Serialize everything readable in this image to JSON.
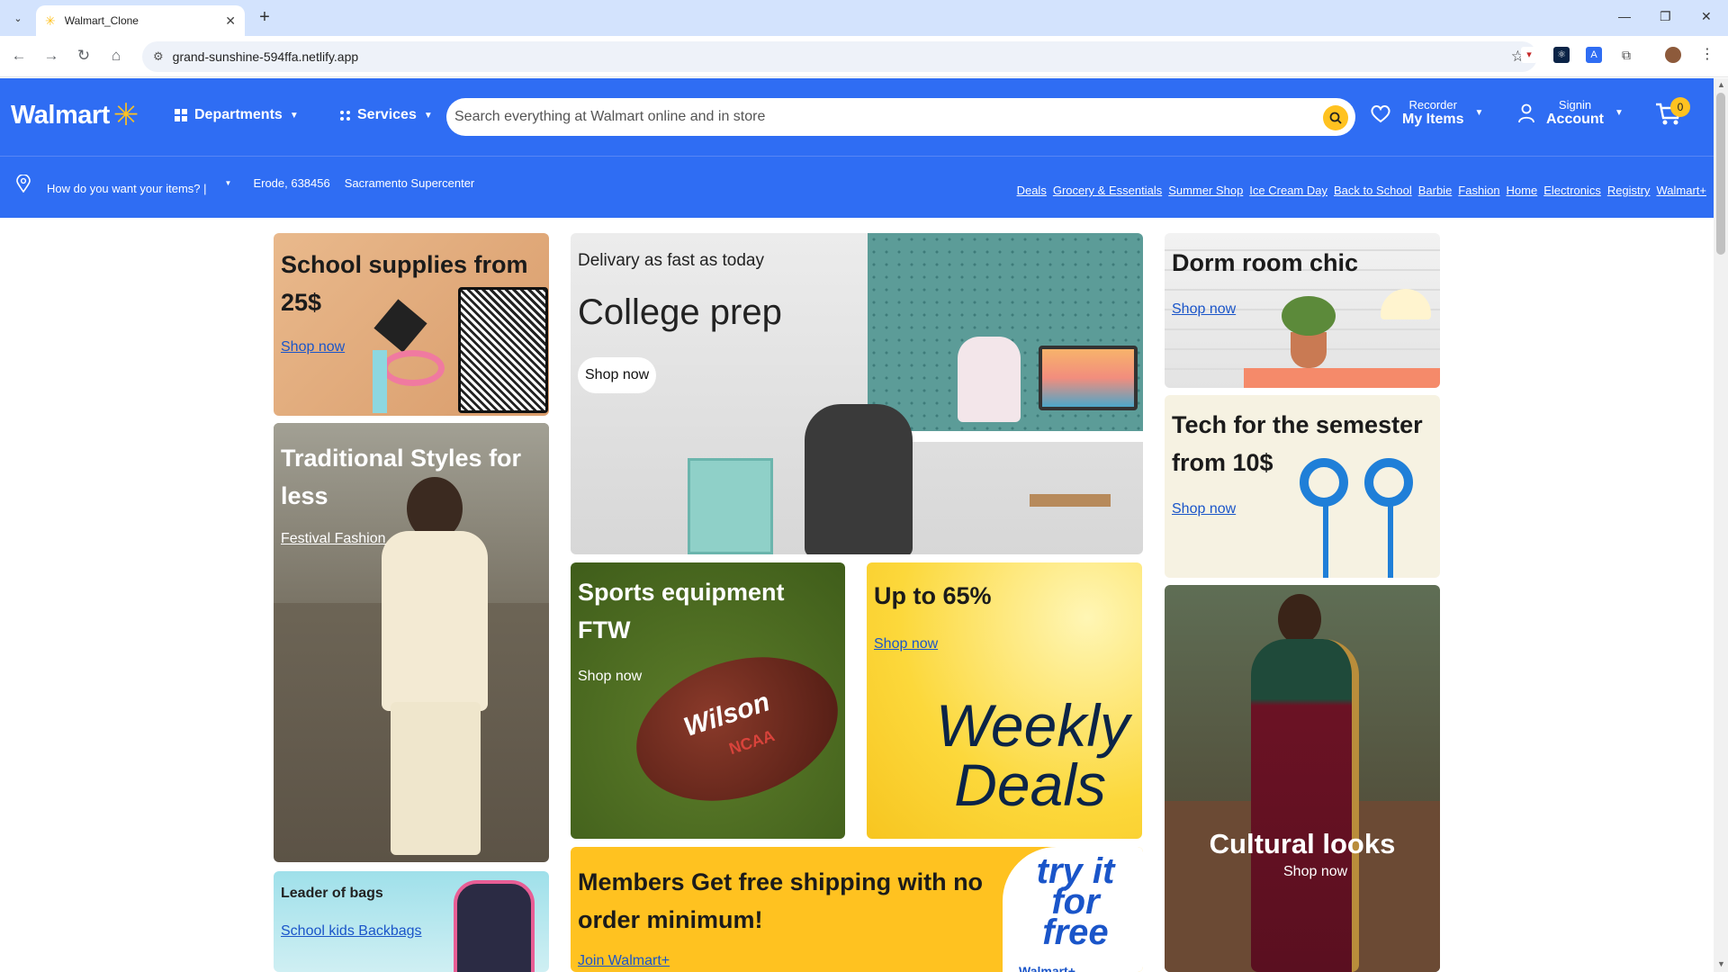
{
  "browser": {
    "tab_title": "Walmart_Clone",
    "url": "grand-sunshine-594ffa.netlify.app"
  },
  "header": {
    "logo_text": "Walmart",
    "departments": "Departments",
    "services": "Services",
    "search_placeholder": "Search everything at Walmart online and in store",
    "reorder_small": "Recorder",
    "reorder_big": "My Items",
    "account_small": "Signin",
    "account_big": "Account",
    "cart_count": "0"
  },
  "subbar": {
    "how": "How do you want your items? |",
    "zip": "Erode, 638456",
    "store": "Sacramento Supercenter",
    "links": [
      "Deals",
      "Grocery & Essentials",
      "Summer Shop",
      "Ice Cream Day",
      "Back to School",
      "Barbie",
      "Fashion",
      "Home",
      "Electronics",
      "Registry",
      "Walmart+"
    ]
  },
  "cards": {
    "school": {
      "title": "School supplies from 25$",
      "link": "Shop now"
    },
    "traditional": {
      "title": "Traditional Styles for less",
      "link": "Festival Fashion"
    },
    "bags": {
      "title": "Leader of bags",
      "link": "School kids Backbags"
    },
    "college": {
      "kicker": "Delivary as fast as today",
      "title": "College prep",
      "button": "Shop now"
    },
    "sports": {
      "title": "Sports equipment FTW",
      "link": "Shop now",
      "ball_brand": "Wilson",
      "ball_ncaa": "NCAA"
    },
    "deals": {
      "title": "Up to 65%",
      "link": "Shop now",
      "script1": "Weekly",
      "script2": "Deals"
    },
    "members": {
      "title": "Members Get free shipping with no order minimum!",
      "link": "Join Walmart+",
      "badge": "try it for free",
      "badge_sub": "Walmart+"
    },
    "dorm": {
      "title": "Dorm room chic",
      "link": "Shop now"
    },
    "tech": {
      "title": "Tech for the semester from 10$",
      "link": "Shop now"
    },
    "cultural": {
      "title": "Cultural looks",
      "link": "Shop now"
    }
  }
}
